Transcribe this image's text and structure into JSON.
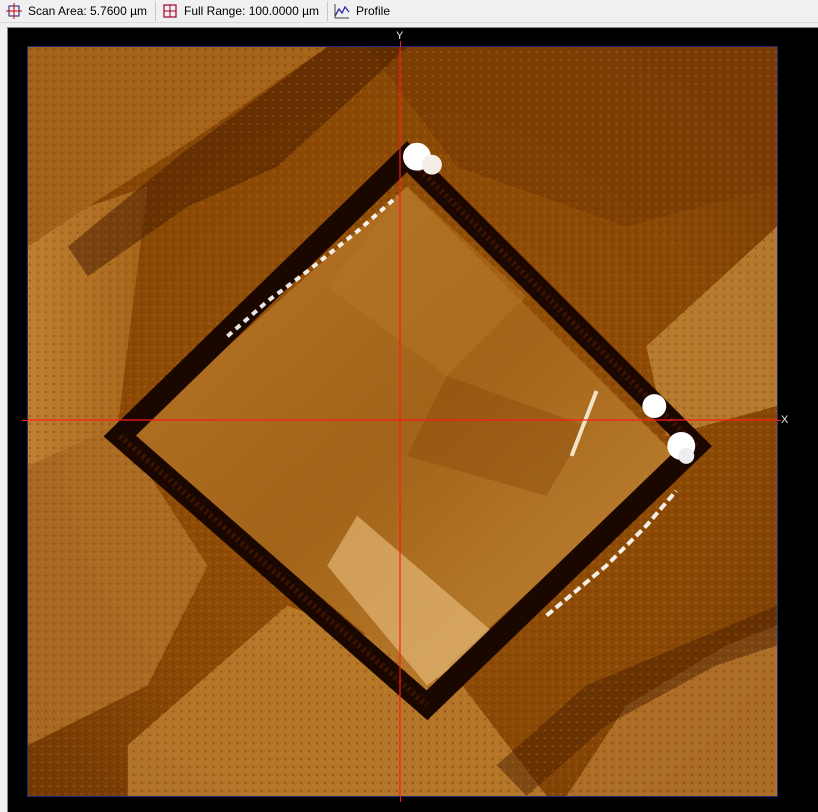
{
  "toolbar": {
    "scan_area_label": "Scan Area: 5.7600 µm",
    "full_range_label": "Full Range: 100.0000 µm",
    "profile_label": "Profile"
  },
  "image_view": {
    "x_axis_label": "X",
    "y_axis_label": "Y",
    "crosshair_color": "#ff1a1a",
    "palette": [
      "#2a0f00",
      "#6b3400",
      "#a65f0a",
      "#d08a2c",
      "#f5e6c8",
      "#ffffff"
    ]
  }
}
